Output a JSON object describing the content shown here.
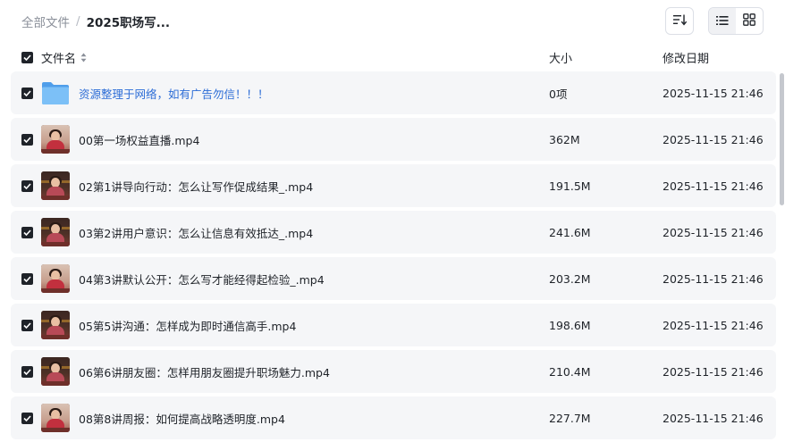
{
  "breadcrumb": {
    "root": "全部文件",
    "separator": "/",
    "current": "2025职场写..."
  },
  "columns": {
    "name": "文件名",
    "size": "大小",
    "date": "修改日期"
  },
  "files": [
    {
      "name": "资源整理于网络，如有广告勿信！！！",
      "size": "0项",
      "date": "2025-11-15 21:46",
      "type": "folder"
    },
    {
      "name": "00第一场权益直播.mp4",
      "size": "362M",
      "date": "2025-11-15 21:46",
      "type": "video"
    },
    {
      "name": "02第1讲导向行动：怎么让写作促成结果_.mp4",
      "size": "191.5M",
      "date": "2025-11-15 21:46",
      "type": "video"
    },
    {
      "name": "03第2讲用户意识：怎么让信息有效抵达_.mp4",
      "size": "241.6M",
      "date": "2025-11-15 21:46",
      "type": "video"
    },
    {
      "name": "04第3讲默认公开：怎么写才能经得起检验_.mp4",
      "size": "203.2M",
      "date": "2025-11-15 21:46",
      "type": "video"
    },
    {
      "name": "05第5讲沟通：怎样成为即时通信高手.mp4",
      "size": "198.6M",
      "date": "2025-11-15 21:46",
      "type": "video"
    },
    {
      "name": "06第6讲朋友圈：怎样用朋友圈提升职场魅力.mp4",
      "size": "210.4M",
      "date": "2025-11-15 21:46",
      "type": "video"
    },
    {
      "name": "08第8讲周报：如何提高战略透明度.mp4",
      "size": "227.7M",
      "date": "2025-11-15 21:46",
      "type": "video"
    }
  ],
  "icons": {
    "sort": "sort-icon",
    "list_view": "list-view-icon",
    "grid_view": "grid-view-icon",
    "checkbox": "checkbox-checked-icon",
    "folder": "folder-icon",
    "video_thumbnail": "video-thumbnail"
  },
  "colors": {
    "link": "#2b6cd6",
    "row_bg": "#f5f6f8",
    "folder": "#5aa9f0",
    "checkbox": "#1f2329"
  }
}
